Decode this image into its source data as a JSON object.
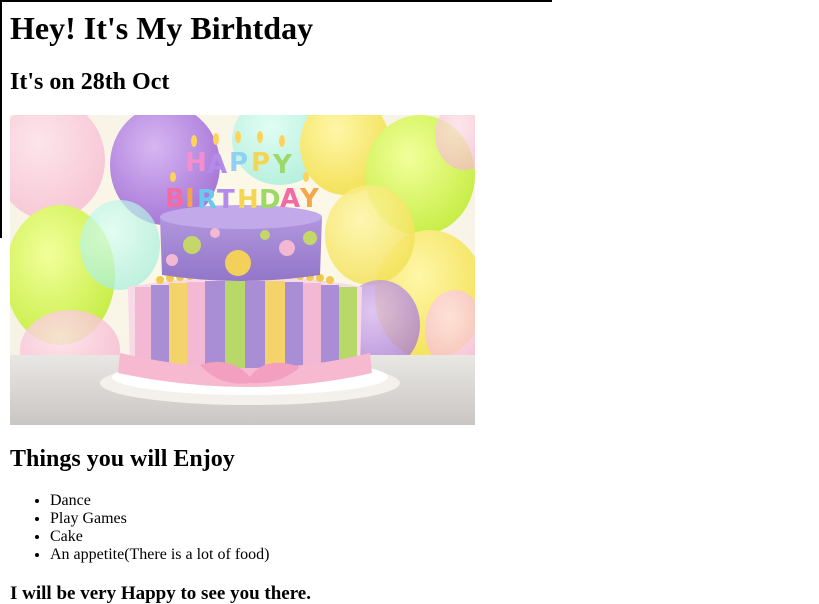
{
  "page": {
    "title": "Hey! It's My Birhtday",
    "subtitle": "It's on 28th Oct",
    "image": {
      "alt_semantic": "birthday-cake-image",
      "candle_text_top": "HAPPY",
      "candle_text_bottom": "BIRTHDAY"
    },
    "section_heading": "Things you will Enjoy",
    "items": [
      "Dance",
      "Play Games",
      "Cake",
      "An appetite(There is a lot of food)"
    ],
    "closing": "I will be very Happy to see you there."
  },
  "colors": {
    "text": "#000000",
    "background": "#ffffff"
  }
}
